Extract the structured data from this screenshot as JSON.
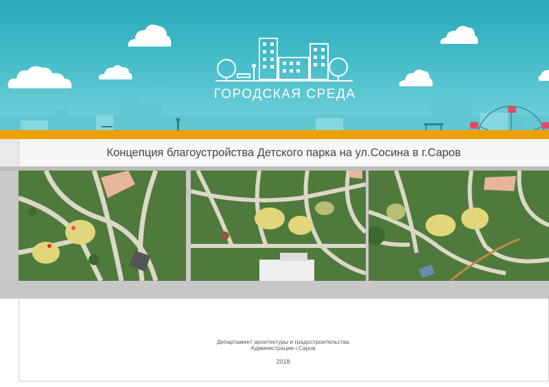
{
  "header": {
    "logo_text": "ГОРОДСКАЯ СРЕДА",
    "colors": {
      "sky_top": "#2aa9b8",
      "sky_bottom": "#74d2dc",
      "accent_orange": "#eea000"
    }
  },
  "title": "Концепция благоустройства Детского парка на ул.Сосина в г.Саров",
  "plans": [
    {
      "name": "masterplan-fragment-1",
      "icon": "park-plan-image"
    },
    {
      "name": "masterplan-fragment-2",
      "icon": "park-plan-image"
    },
    {
      "name": "masterplan-fragment-3",
      "icon": "park-plan-image"
    }
  ],
  "footer": {
    "department_line1": "Департамент архитектуры и градостроительства",
    "department_line2": "Администрации г.Саров",
    "year": "2018"
  }
}
